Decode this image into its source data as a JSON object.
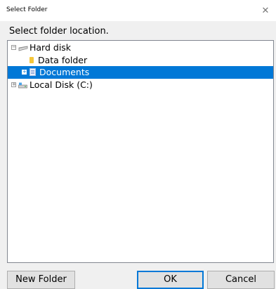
{
  "window": {
    "title": "Select Folder"
  },
  "prompt": "Select folder location.",
  "tree": {
    "items": [
      {
        "label": "Hard disk",
        "expander": "−",
        "icon": "hard-disk-icon"
      },
      {
        "label": "Data folder",
        "icon": "folder-icon"
      },
      {
        "label": "Documents",
        "expander": "+",
        "icon": "documents-icon",
        "selected": true
      },
      {
        "label": "Local Disk (C:)",
        "expander": "+",
        "icon": "local-disk-icon"
      }
    ]
  },
  "buttons": {
    "new_folder": "New Folder",
    "ok": "OK",
    "cancel": "Cancel"
  },
  "colors": {
    "selection": "#0078d7",
    "button_face": "#e1e1e1"
  }
}
